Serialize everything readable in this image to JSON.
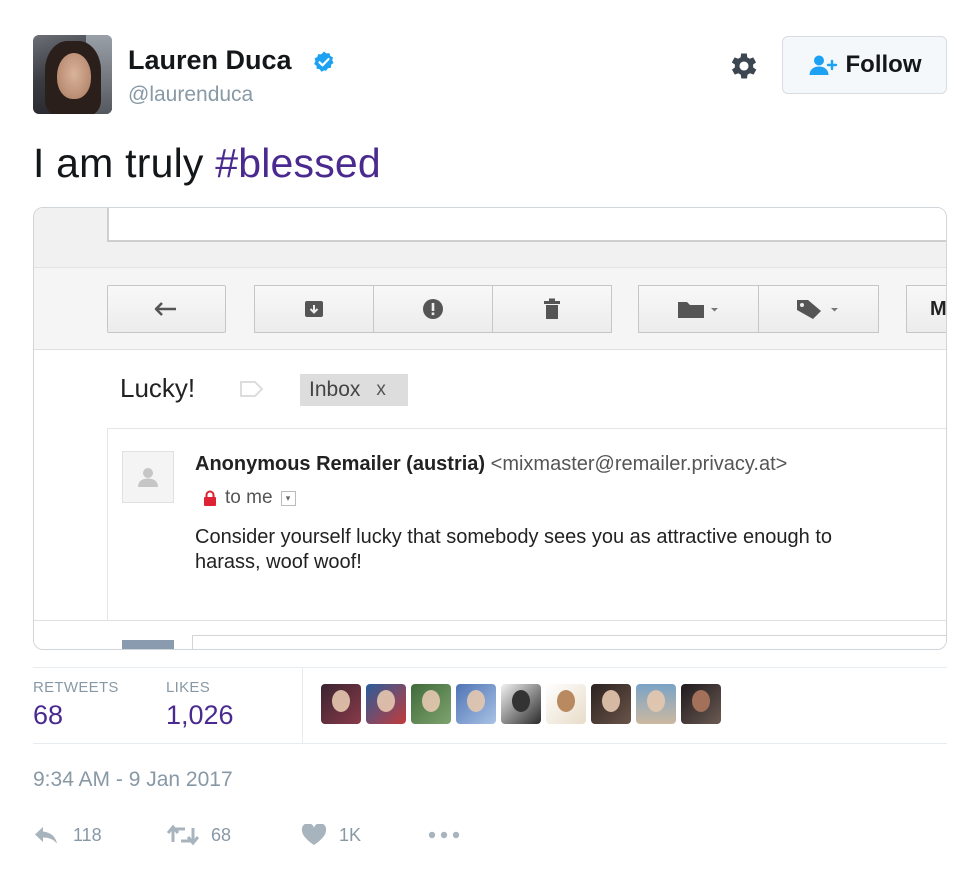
{
  "user": {
    "display_name": "Lauren Duca",
    "handle": "@laurenduca"
  },
  "follow_button": {
    "label": "Follow"
  },
  "tweet": {
    "text": "I am truly ",
    "hashtag": "#blessed"
  },
  "email": {
    "subject": "Lucky!",
    "label": "Inbox",
    "label_remove": "x",
    "sender_name": "Anonymous Remailer (austria)",
    "sender_address": "<mixmaster@remailer.privacy.at>",
    "recipient": "to me",
    "body": "Consider yourself lucky that somebody sees you as attractive enough to harass, woof woof!",
    "toolbar_more": "M"
  },
  "stats": {
    "retweets_label": "RETWEETS",
    "retweets_value": "68",
    "likes_label": "LIKES",
    "likes_value": "1,026"
  },
  "timestamp": "9:34 AM - 9 Jan 2017",
  "actions": {
    "reply_count": "118",
    "retweet_count": "68",
    "like_count": "1K"
  },
  "colors": {
    "hashtag": "#4b2a8f",
    "verified": "#1da1f2",
    "secondary_text": "#8899a6",
    "follow_icon": "#1da1f2"
  },
  "icons": [
    "verified-badge-icon",
    "gear-icon",
    "follow-person-icon",
    "reply-arrow-icon",
    "archive-icon",
    "spam-icon",
    "trash-icon",
    "folder-icon",
    "tag-icon",
    "lock-icon",
    "reply-icon",
    "retweet-icon",
    "heart-icon",
    "more-icon"
  ]
}
